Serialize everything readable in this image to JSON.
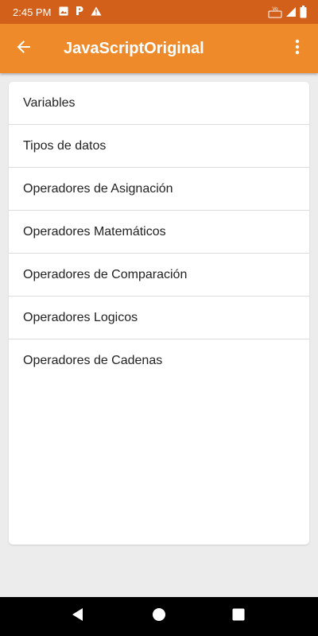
{
  "status_bar": {
    "time": "2:45 PM",
    "icons": [
      "image-icon",
      "parking-icon",
      "warning-icon",
      "volte-icon",
      "signal-icon",
      "battery-icon"
    ],
    "network_label": "LTE"
  },
  "app_bar": {
    "title": "JavaScriptOriginal",
    "color": "#ef8a2a",
    "back_icon": "arrow-back-icon",
    "menu_icon": "more-vert-icon"
  },
  "topics": [
    {
      "label": "Variables"
    },
    {
      "label": "Tipos de datos"
    },
    {
      "label": "Operadores de Asignación"
    },
    {
      "label": "Operadores Matemáticos"
    },
    {
      "label": "Operadores de Comparación"
    },
    {
      "label": "Operadores Logicos"
    },
    {
      "label": "Operadores de Cadenas"
    }
  ],
  "nav_bar": {
    "icons": [
      "back-triangle-icon",
      "home-circle-icon",
      "recents-square-icon"
    ]
  }
}
